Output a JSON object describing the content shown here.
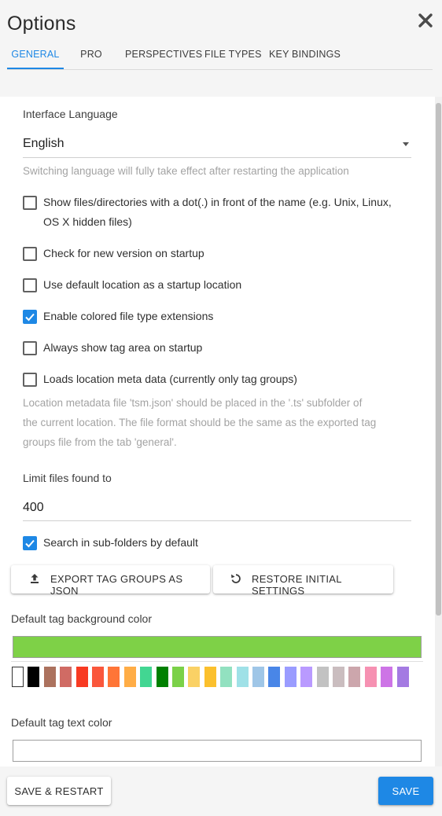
{
  "dialog": {
    "title": "Options",
    "close_icon": "close-icon"
  },
  "tabs": [
    {
      "label": "GENERAL",
      "active": true
    },
    {
      "label": "PRO"
    },
    {
      "label": "PERSPECTIVES"
    },
    {
      "label": "FILE TYPES"
    },
    {
      "label": "KEY BINDINGS"
    }
  ],
  "language": {
    "label": "Interface Language",
    "value": "English",
    "help": "Switching language will fully take effect after restarting the application"
  },
  "checkboxes": [
    {
      "line1": "Show files/directories with a dot(.) in front of the name (e.g. Unix, Linux,",
      "line2": "OS X hidden files)",
      "checked": false
    },
    {
      "line1": "Check for new version on startup",
      "checked": false
    },
    {
      "line1": "Use default location as a startup location",
      "checked": false
    },
    {
      "line1": "Enable colored file type extensions",
      "checked": true
    },
    {
      "line1": "Always show tag area on startup",
      "checked": false
    },
    {
      "line1": "Loads location meta data (currently only tag groups)",
      "checked": false
    }
  ],
  "metadata_help": {
    "line1": "Location metadata file 'tsm.json' should be placed in the '.ts' subfolder of",
    "line2": "the current location. The file format should be the same as the exported tag",
    "line3": "groups file from the tab 'general'."
  },
  "limit": {
    "label": "Limit files found to",
    "value": "400"
  },
  "search_subfolders": {
    "label": "Search in sub-folders by default",
    "checked": true
  },
  "buttons": {
    "export": "EXPORT TAG GROUPS AS JSON",
    "restore": "RESTORE INITIAL SETTINGS"
  },
  "tag_bg": {
    "label": "Default tag background color",
    "value_color": "#7ed147"
  },
  "palette": [
    "#ffffff",
    "#000000",
    "#ac725e",
    "#d06b64",
    "#f83a22",
    "#fa573c",
    "#ff7537",
    "#ffad46",
    "#42d692",
    "#008000",
    "#7bd148",
    "#fad165",
    "#fbc02d",
    "#92e1c0",
    "#9fe1e7",
    "#9fc6e7",
    "#4986e7",
    "#9a9cff",
    "#b99aff",
    "#c2c2c2",
    "#cabdbf",
    "#cca6ac",
    "#f691b2",
    "#cd74e6",
    "#a47ae2"
  ],
  "tag_text": {
    "label": "Default tag text color",
    "value_color": "#ffffff"
  },
  "footer": {
    "save_restart": "SAVE & RESTART",
    "save": "SAVE"
  },
  "colors": {
    "accent": "#1e88e5"
  }
}
